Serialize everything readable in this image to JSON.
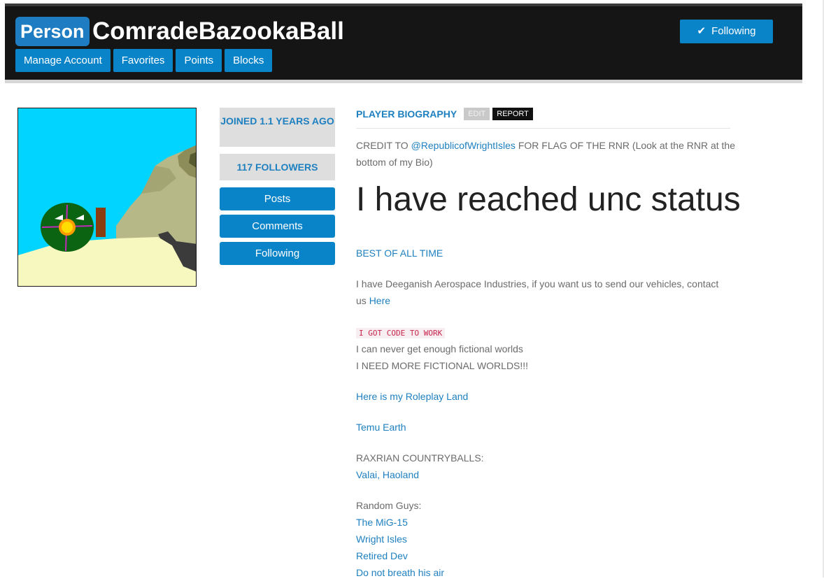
{
  "header": {
    "badge": "Person",
    "username": "ComradeBazookaBall",
    "nav": [
      "Manage Account",
      "Favorites",
      "Points",
      "Blocks"
    ],
    "follow_label": "Following"
  },
  "sidebar": {
    "joined": "JOINED 1.1 YEARS AGO",
    "followers": "117 FOLLOWERS",
    "buttons": [
      "Posts",
      "Comments",
      "Following"
    ]
  },
  "bio": {
    "title": "PLAYER BIOGRAPHY",
    "edit_label": "EDIT",
    "report_label": "REPORT",
    "credit_prefix": "CREDIT TO ",
    "credit_link": "@RepublicofWrightIsles",
    "credit_suffix": " FOR FLAG OF THE RNR (Look at the RNR at the bottom of my Bio)",
    "headline": "I have reached unc status",
    "best_link": "BEST OF ALL TIME",
    "aerospace_text1": "I have Deeganish Aerospace Industries, if you want us to send our vehicles, contact",
    "aerospace_text2": "us ",
    "aerospace_link": "Here",
    "code_text": "I GOT CODE TO WORK",
    "worlds1": "I can never get enough fictional worlds",
    "worlds2": "I NEED MORE FICTIONAL WORLDS!!!",
    "roleplay_link": "Here is my Roleplay Land",
    "temu_link": "Temu Earth",
    "raxrian_label": "RAXRIAN COUNTRYBALLS:",
    "raxrian_link": "Valai, Haoland",
    "random_label": "Random Guys:",
    "random_links": [
      "The MiG-15",
      "Wright Isles",
      "Retired Dev",
      "Do not breath his air"
    ]
  },
  "colors": {
    "accent": "#0a84c9",
    "header_bg": "#151515",
    "link": "#1f80c0"
  },
  "icons": {
    "follow": "checkmark-icon"
  }
}
